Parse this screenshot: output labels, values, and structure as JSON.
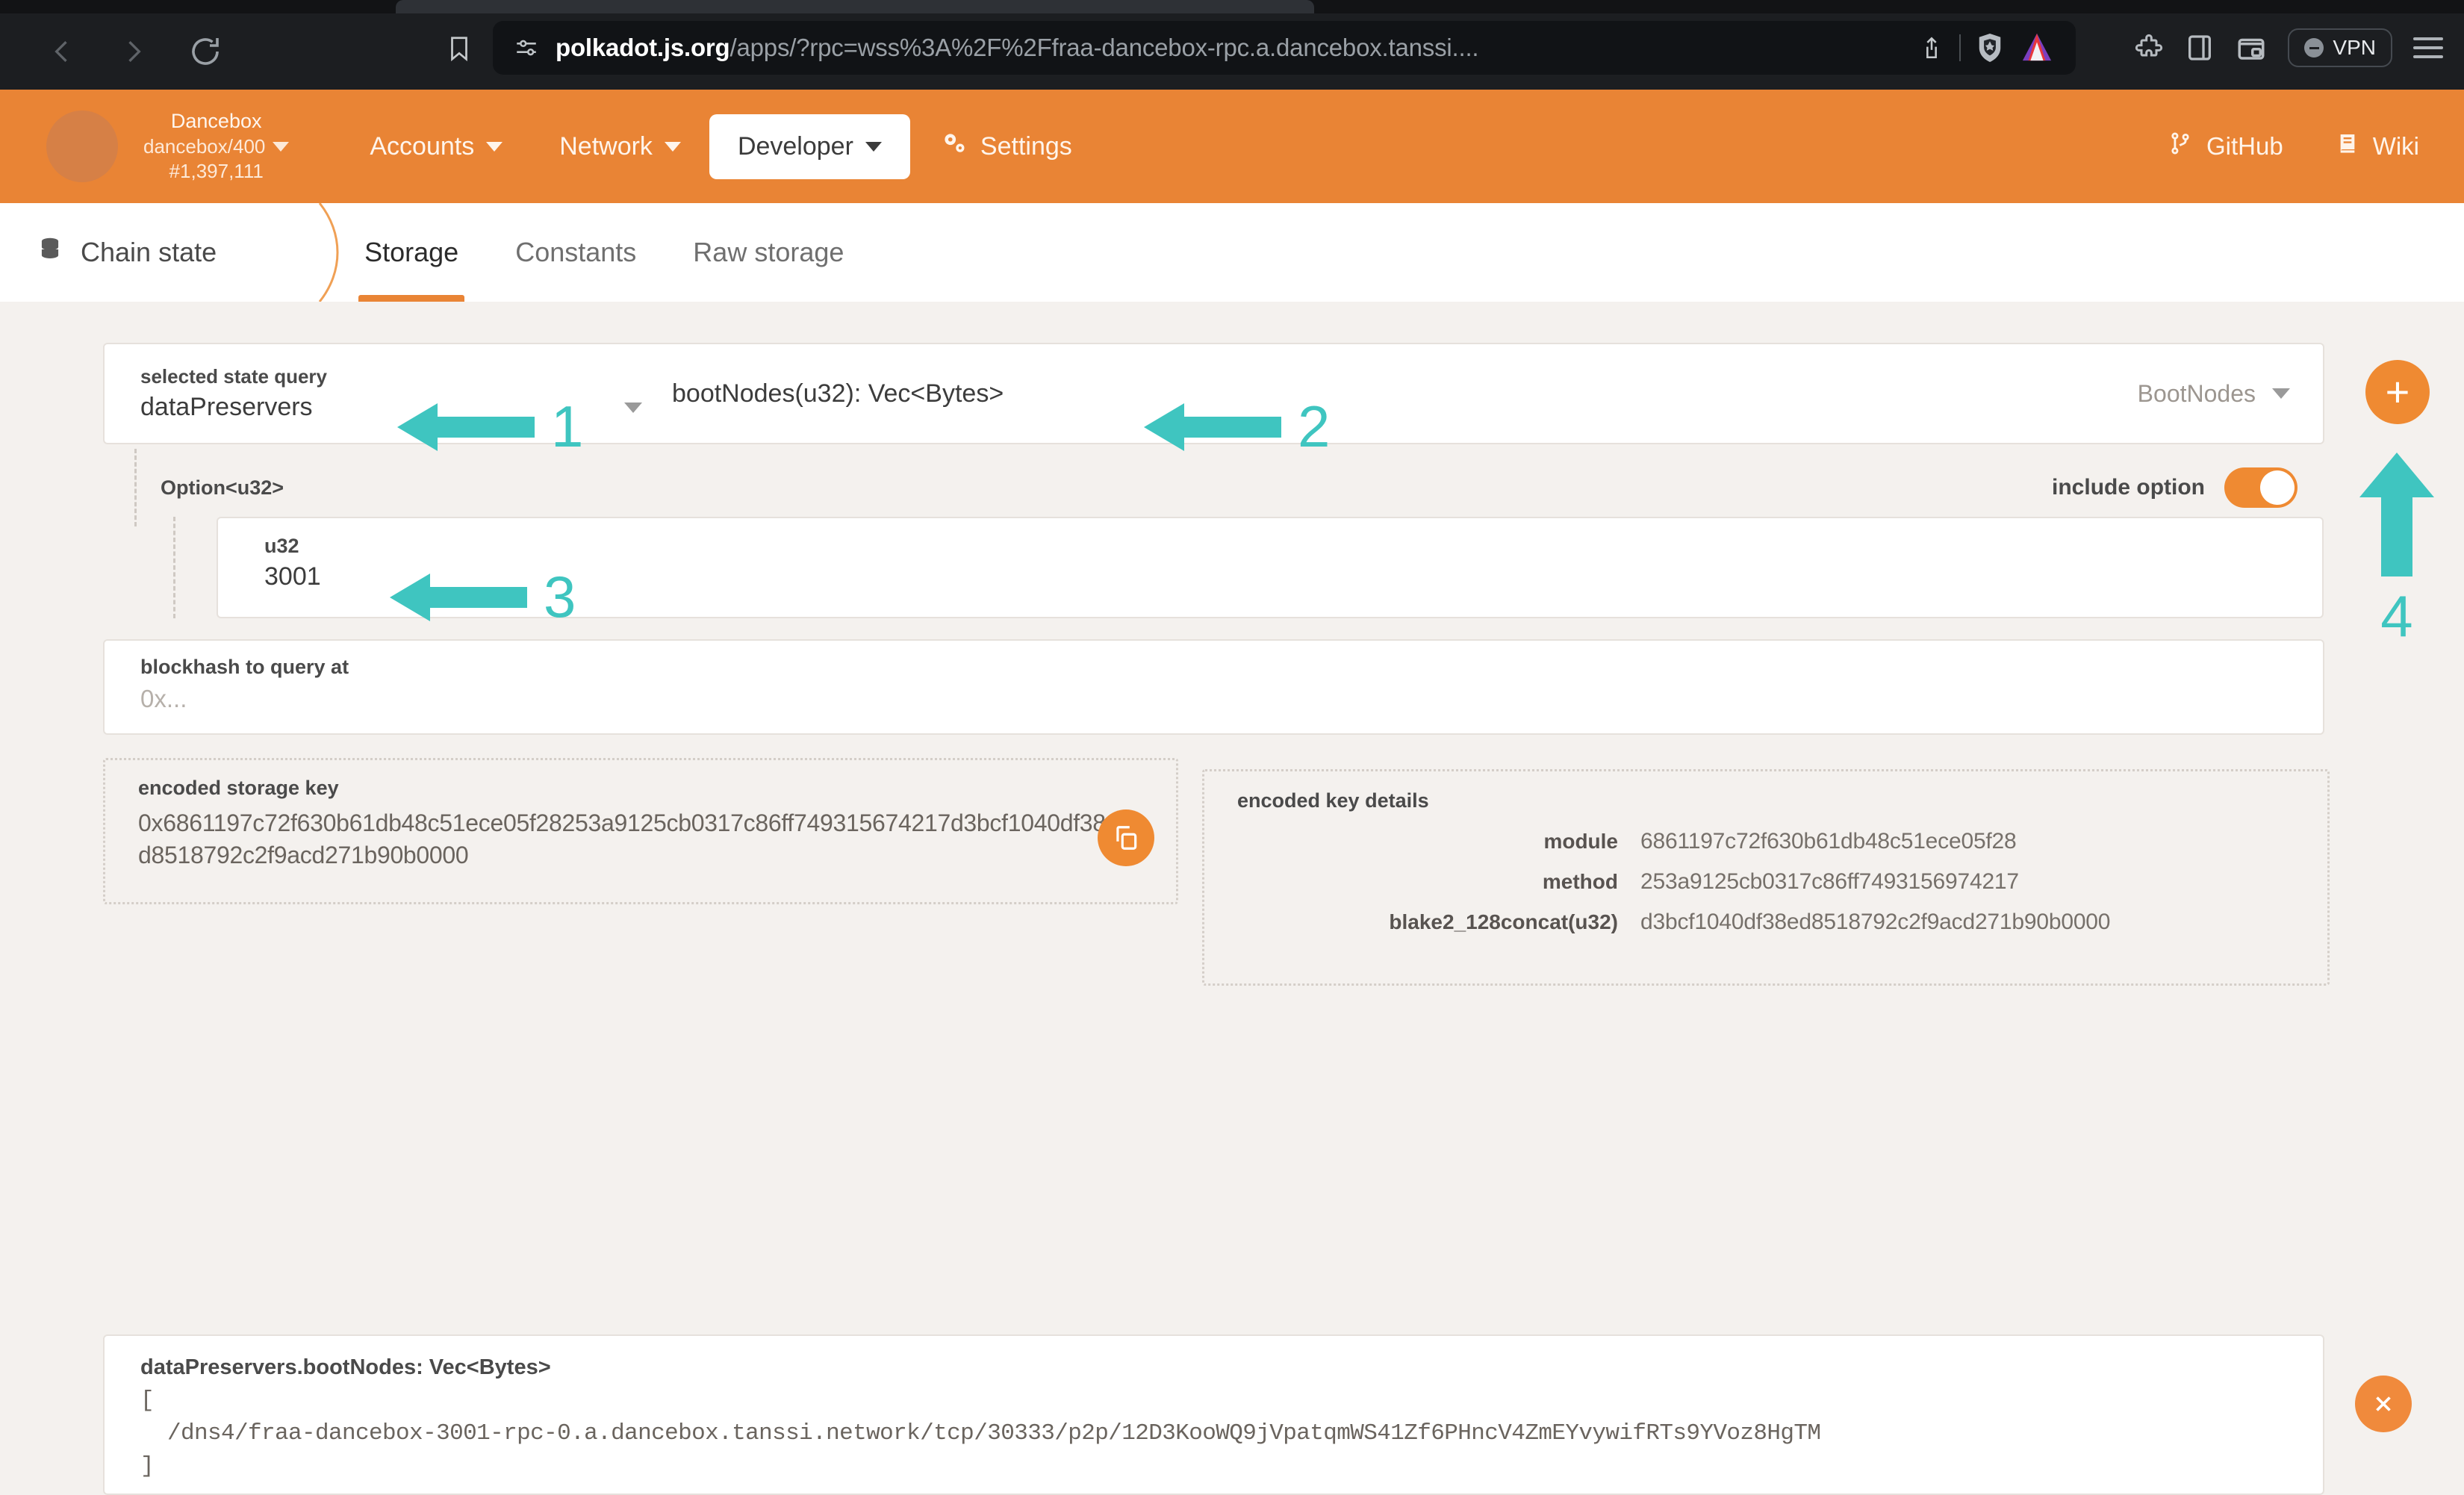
{
  "browser": {
    "url_domain": "polkadot.js.org",
    "url_path": "/apps/?rpc=wss%3A%2F%2Ffraa-dancebox-rpc.a.dancebox.tanssi....",
    "vpn_label": "VPN",
    "icons": {
      "back": "back-arrow-icon",
      "forward": "forward-arrow-icon",
      "reload": "reload-icon",
      "bookmark": "bookmark-icon",
      "tune": "site-settings-icon",
      "share": "share-icon",
      "shield": "brave-shield-icon",
      "leo": "brave-leo-icon",
      "extensions": "puzzle-icon",
      "sidebar": "sidebar-panel-icon",
      "wallet": "brave-wallet-icon",
      "menu": "hamburger-menu-icon"
    }
  },
  "appbar": {
    "chain_name": "Dancebox",
    "chain_endpoint": "dancebox/400",
    "block_number": "#1,397,111",
    "nav": [
      {
        "label": "Accounts",
        "active": false,
        "has_caret": true
      },
      {
        "label": "Network",
        "active": false,
        "has_caret": true
      },
      {
        "label": "Developer",
        "active": true,
        "has_caret": true
      },
      {
        "label": "Settings",
        "active": false,
        "has_caret": false,
        "icon": "gears-icon"
      }
    ],
    "right": [
      {
        "label": "GitHub",
        "icon": "git-branch-icon"
      },
      {
        "label": "Wiki",
        "icon": "book-icon"
      }
    ]
  },
  "subbar": {
    "breadcrumb": "Chain state",
    "breadcrumb_icon": "database-icon",
    "tabs": [
      {
        "label": "Storage",
        "active": true
      },
      {
        "label": "Constants",
        "active": false
      },
      {
        "label": "Raw storage",
        "active": false
      }
    ]
  },
  "query": {
    "label": "selected state query",
    "pallet": "dataPreservers",
    "method": "bootNodes(u32): Vec<Bytes>",
    "hint": "BootNodes",
    "add_button": "+"
  },
  "option": {
    "label": "Option<u32>",
    "include_option_label": "include option",
    "include_option_on": true
  },
  "u32_param": {
    "label": "u32",
    "value": "3001"
  },
  "blockhash": {
    "label": "blockhash to query at",
    "placeholder": "0x..."
  },
  "encoded_storage_key": {
    "label": "encoded storage key",
    "value": "0x6861197c72f630b61db48c51ece05f28253a9125cb0317c86ff749315674217d3bcf1040df38ed8518792c2f9acd271b90b0000",
    "line1": "0x6861197c72f630b61db48c51ece05f28253a9125cb0317c86ff7493156",
    "line2": "74217d3bcf1040df38ed8518792c2f9acd271b90b0000",
    "copy_icon": "copy-icon"
  },
  "encoded_key_details": {
    "label": "encoded key details",
    "rows": [
      {
        "key": "module",
        "value": "6861197c72f630b61db48c51ece05f28"
      },
      {
        "key": "method",
        "value": "253a9125cb0317c86ff7493156974217"
      },
      {
        "key": "blake2_128concat(u32)",
        "value": "d3bcf1040df38ed8518792c2f9acd271b90b0000"
      }
    ]
  },
  "result": {
    "title": "dataPreservers.bootNodes: Vec<Bytes>",
    "body": "[\n  /dns4/fraa-dancebox-3001-rpc-0.a.dancebox.tanssi.network/tcp/30333/p2p/12D3KooWQ9jVpatqmWS41Zf6PHncV4ZmEYvywifRTs9YVoz8HgTM\n]",
    "close_icon": "close-icon"
  },
  "annotations": [
    {
      "number": "1",
      "target": "pallet-select"
    },
    {
      "number": "2",
      "target": "method-select"
    },
    {
      "number": "3",
      "target": "u32-value"
    },
    {
      "number": "4",
      "target": "add-query-button"
    }
  ],
  "colors": {
    "brand_orange": "#e98435",
    "accent_orange": "#ef8a32",
    "annotation_teal": "#3fc5c0",
    "page_bg": "#f4f1ee",
    "chrome_bg": "#1c1e21"
  }
}
